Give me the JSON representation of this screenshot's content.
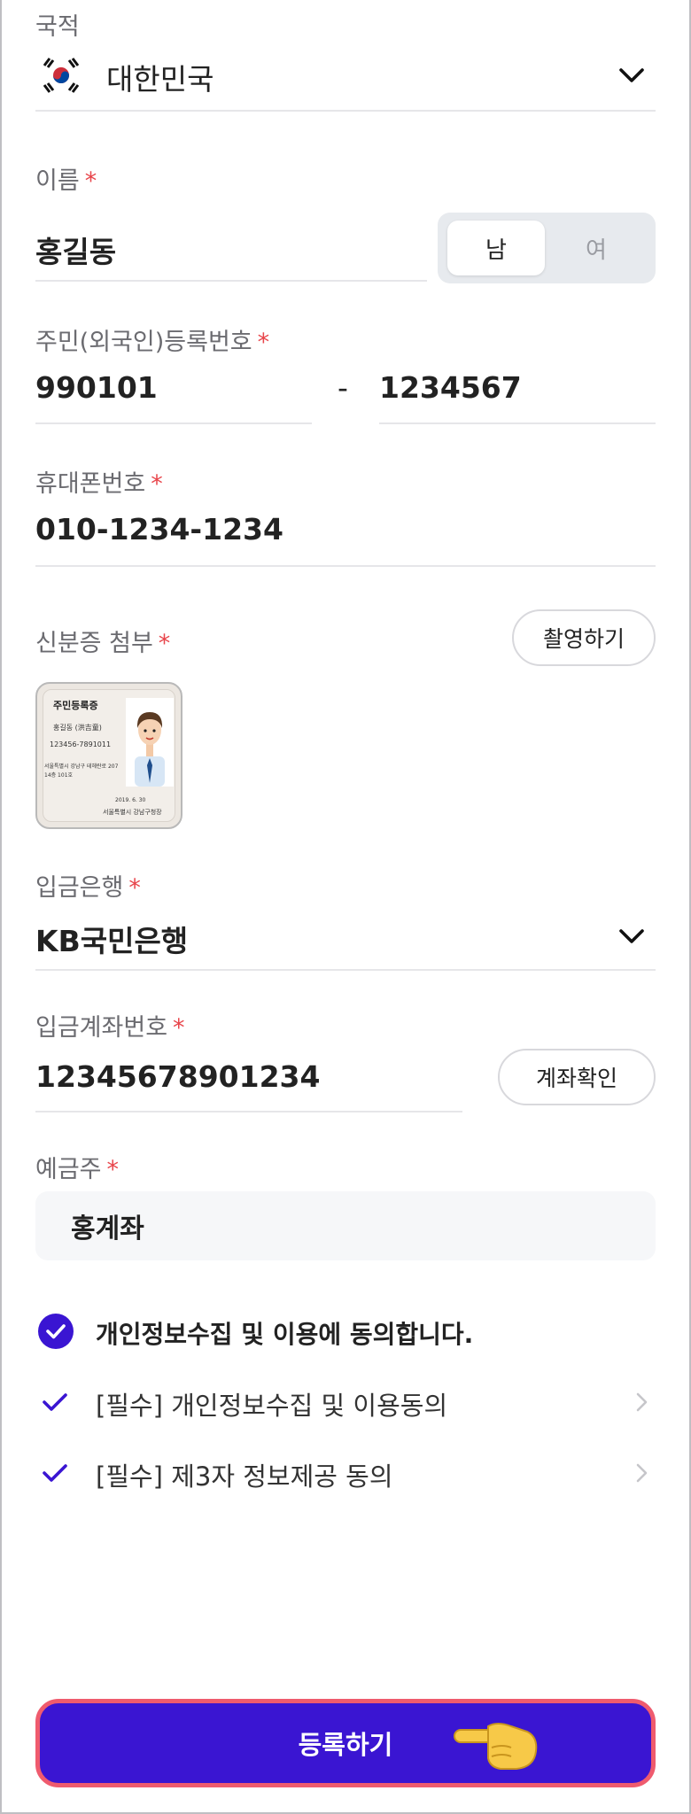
{
  "nationality": {
    "label": "국적",
    "value": "대한민국",
    "flag_icon": "korea-flag-icon"
  },
  "name": {
    "label": "이름",
    "required_mark": "*",
    "value": "홍길동"
  },
  "gender": {
    "male": "남",
    "female": "여",
    "selected": "남"
  },
  "resident_id": {
    "label": "주민(외국인)등록번호",
    "required_mark": "*",
    "front": "990101",
    "separator": "-",
    "back": "1234567"
  },
  "phone": {
    "label": "휴대폰번호",
    "required_mark": "*",
    "value": "010-1234-1234"
  },
  "id_attach": {
    "label": "신분증 첨부",
    "required_mark": "*",
    "capture_button": "촬영하기",
    "card": {
      "title": "주민등록증",
      "name": "홍길동 (洪吉童)",
      "number": "123456-7891011",
      "address_line1": "서울특별시 강남구 테헤란로 207",
      "address_line2": "14층 101호",
      "date": "2019. 6. 30",
      "issuer": "서울특별시 강남구청장"
    }
  },
  "bank": {
    "label": "입금은행",
    "required_mark": "*",
    "value": "KB국민은행"
  },
  "account": {
    "label": "입금계좌번호",
    "required_mark": "*",
    "value": "12345678901234",
    "verify_button": "계좌확인"
  },
  "holder": {
    "label": "예금주",
    "required_mark": "*",
    "value": "홍계좌"
  },
  "agreements": {
    "all_label": "개인정보수집 및 이용에 동의합니다.",
    "items": [
      {
        "label": "[필수] 개인정보수집 및 이용동의"
      },
      {
        "label": "[필수] 제3자 정보제공 동의"
      }
    ]
  },
  "submit_label": "등록하기",
  "colors": {
    "accent": "#3a15d2",
    "required": "#e8454b",
    "submit_border": "#ef5b6e"
  }
}
